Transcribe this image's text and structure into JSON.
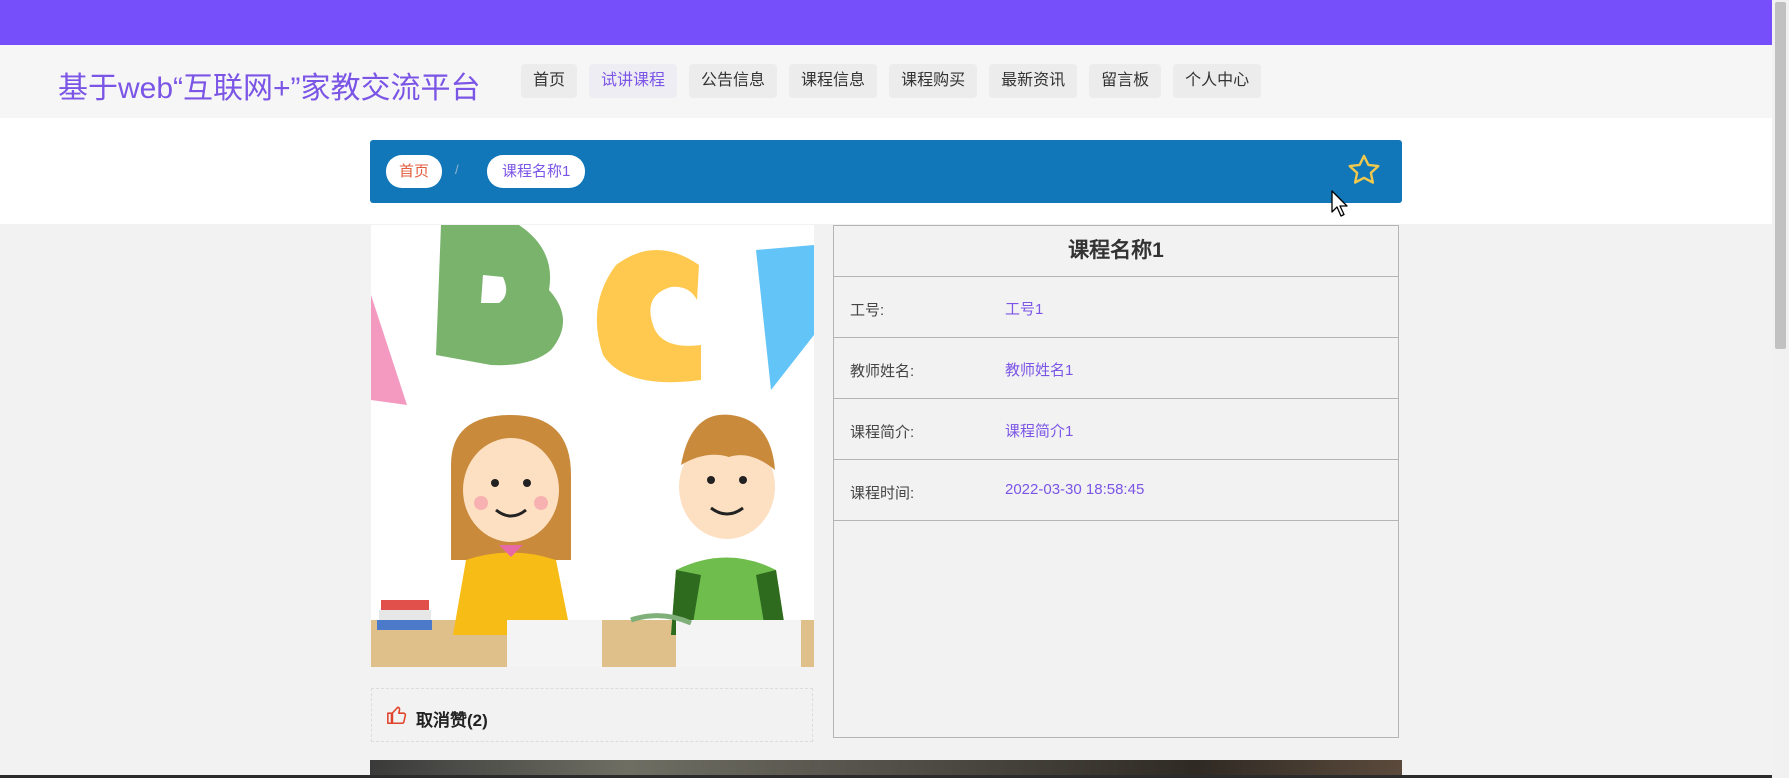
{
  "header": {
    "site_title": "基于web“互联网+”家教交流平台",
    "nav": [
      {
        "label": "首页"
      },
      {
        "label": "试讲课程",
        "active": true
      },
      {
        "label": "公告信息"
      },
      {
        "label": "课程信息"
      },
      {
        "label": "课程购买"
      },
      {
        "label": "最新资讯"
      },
      {
        "label": "留言板"
      },
      {
        "label": "个人中心"
      }
    ]
  },
  "breadcrumb": {
    "home": "首页",
    "separator": "/",
    "current": "课程名称1",
    "favorite_icon": "star-outline-icon"
  },
  "detail": {
    "title": "课程名称1",
    "rows": [
      {
        "label": "工号:",
        "value": "工号1"
      },
      {
        "label": "教师姓名:",
        "value": "教师姓名1"
      },
      {
        "label": "课程简介:",
        "value": "课程简介1"
      },
      {
        "label": "课程时间:",
        "value": "2022-03-30 18:58:45"
      }
    ]
  },
  "like": {
    "icon": "thumbs-up-icon",
    "label": "取消赞(2)"
  },
  "colors": {
    "topbar": "#764ffb",
    "accent": "#7b55e6",
    "breadcrumb_bar": "#1177b8",
    "star": "#f2c94c"
  }
}
